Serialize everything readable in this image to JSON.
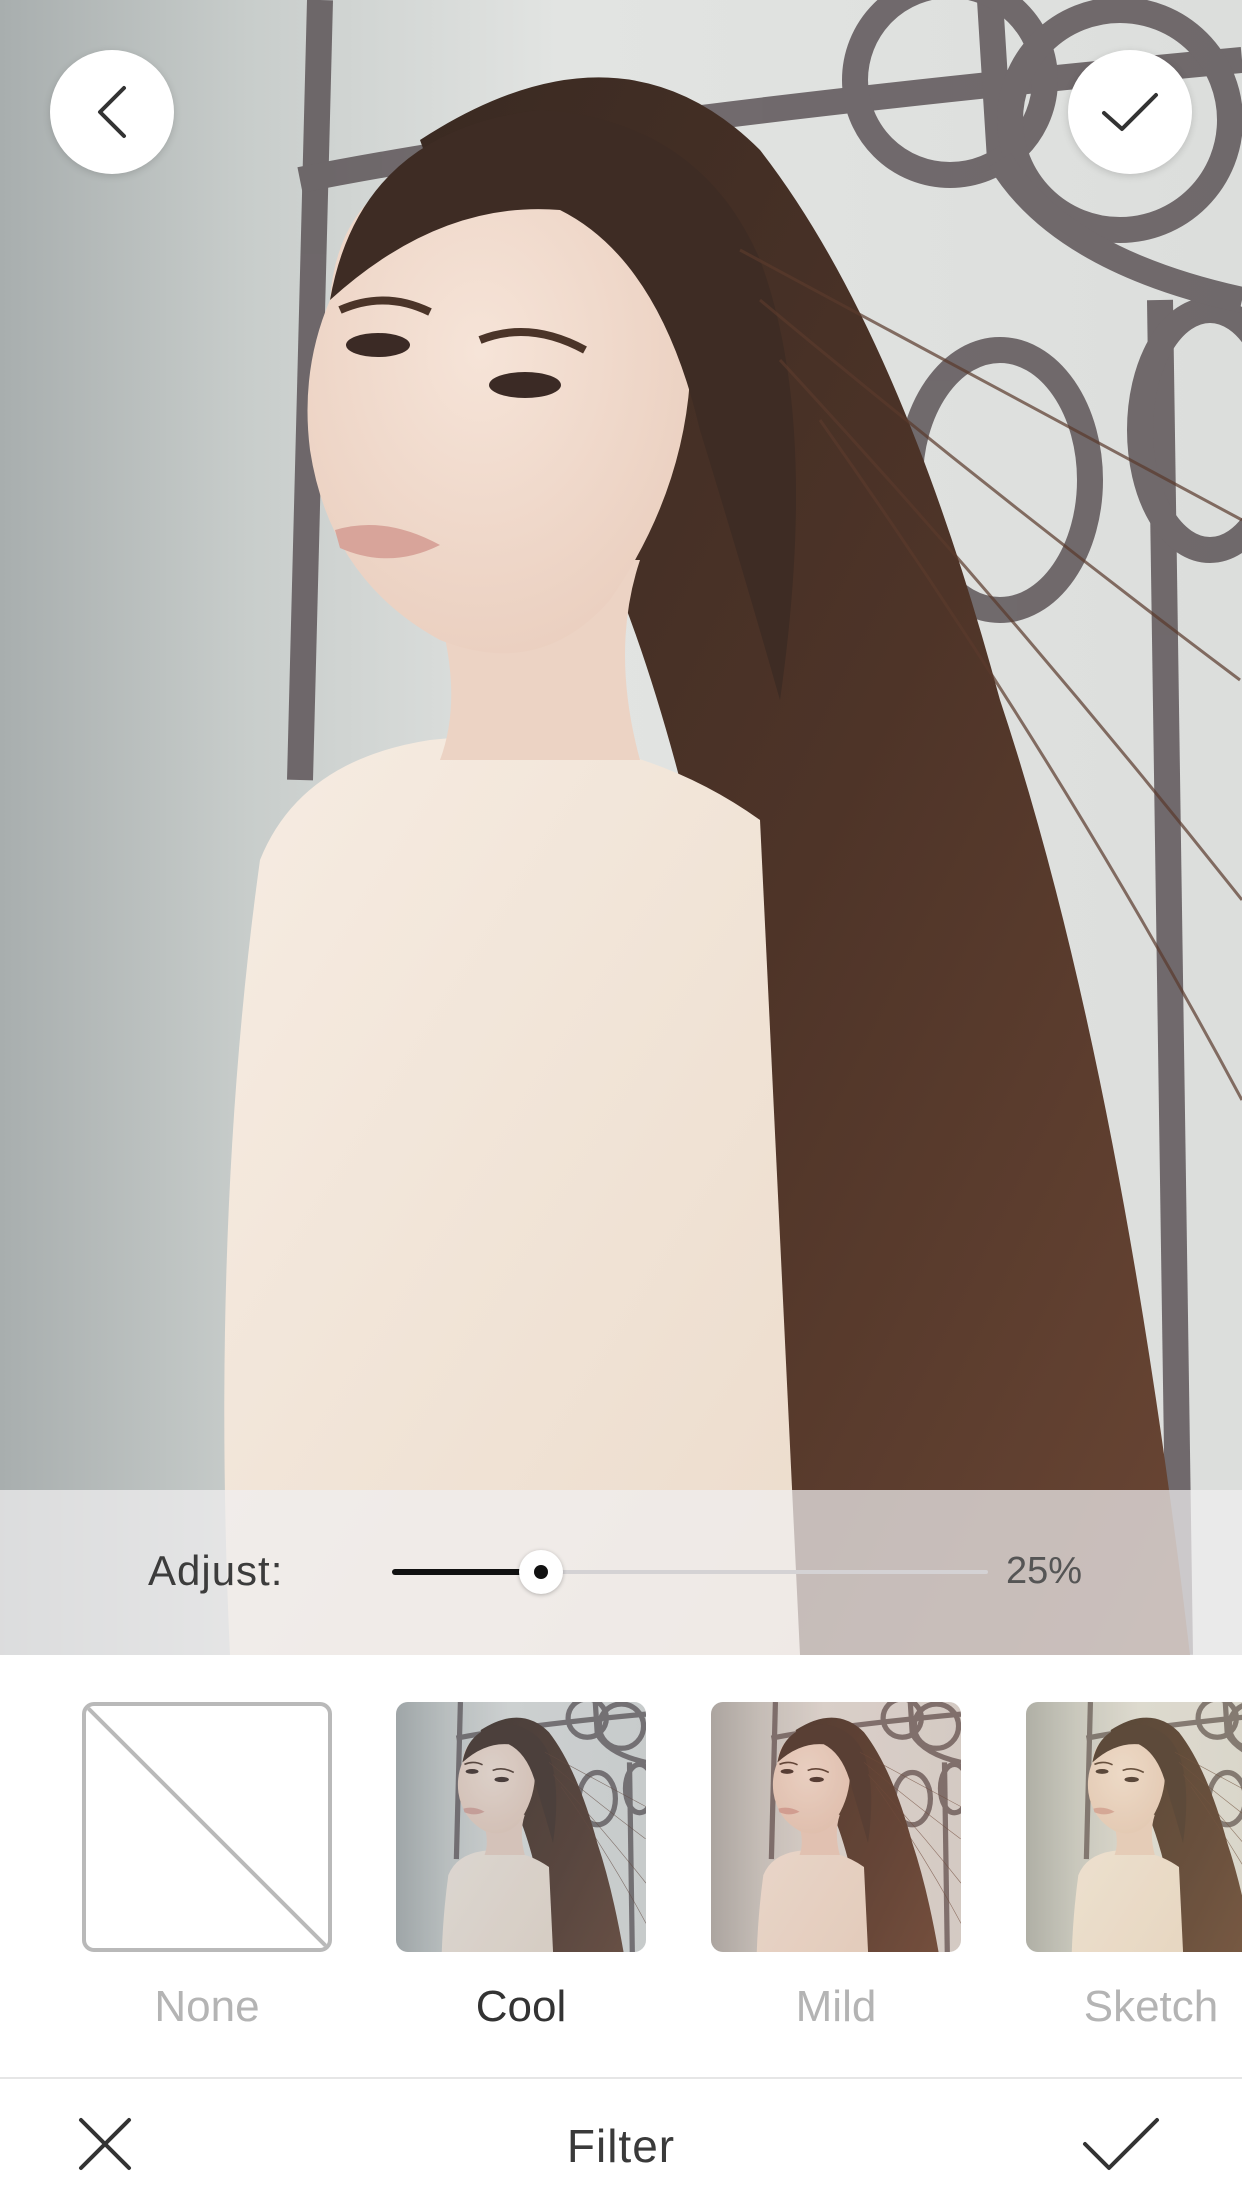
{
  "screen": {
    "title": "Filter"
  },
  "photo": {
    "subject": "portrait photo"
  },
  "top_controls": {
    "back_icon": "chevron-left-icon",
    "confirm_icon": "check-icon"
  },
  "adjust": {
    "label": "Adjust:",
    "value_text": "25%",
    "value_fraction": 0.25
  },
  "filters": [
    {
      "label": "None",
      "active": false,
      "tint": "none"
    },
    {
      "label": "Cool",
      "active": true,
      "tint": "#7f8a92"
    },
    {
      "label": "Mild",
      "active": false,
      "tint": "#b9826f"
    },
    {
      "label": "Sketch",
      "active": false,
      "tint": "#cdb88a"
    }
  ],
  "bottom_bar": {
    "cancel_icon": "close-icon",
    "title": "Filter",
    "apply_icon": "check-icon"
  },
  "colors": {
    "active_label": "#333333",
    "inactive_label": "#b4b4b4",
    "slider_fill": "#111111"
  }
}
